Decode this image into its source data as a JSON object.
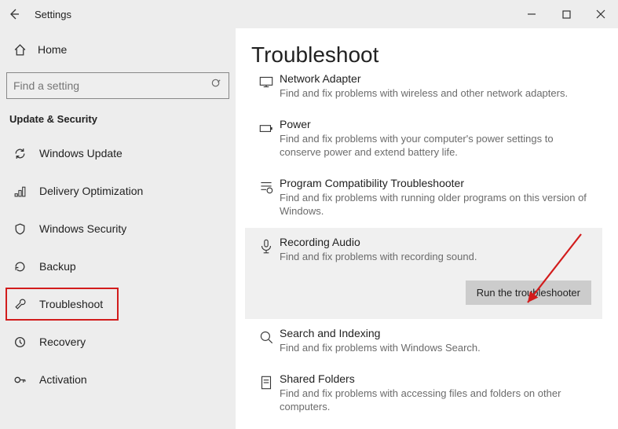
{
  "titlebar": {
    "title": "Settings"
  },
  "sidebar": {
    "home_label": "Home",
    "search_placeholder": "Find a setting",
    "section_label": "Update & Security",
    "items": [
      {
        "label": "Windows Update"
      },
      {
        "label": "Delivery Optimization"
      },
      {
        "label": "Windows Security"
      },
      {
        "label": "Backup"
      },
      {
        "label": "Troubleshoot"
      },
      {
        "label": "Recovery"
      },
      {
        "label": "Activation"
      }
    ]
  },
  "main": {
    "heading": "Troubleshoot",
    "items": [
      {
        "title": "Network Adapter",
        "desc": "Find and fix problems with wireless and other network adapters."
      },
      {
        "title": "Power",
        "desc": "Find and fix problems with your computer's power settings to conserve power and extend battery life."
      },
      {
        "title": "Program Compatibility Troubleshooter",
        "desc": "Find and fix problems with running older programs on this version of Windows."
      },
      {
        "title": "Recording Audio",
        "desc": "Find and fix problems with recording sound."
      },
      {
        "title": "Search and Indexing",
        "desc": "Find and fix problems with Windows Search."
      },
      {
        "title": "Shared Folders",
        "desc": "Find and fix problems with accessing files and folders on other computers."
      }
    ],
    "run_button_label": "Run the troubleshooter"
  }
}
